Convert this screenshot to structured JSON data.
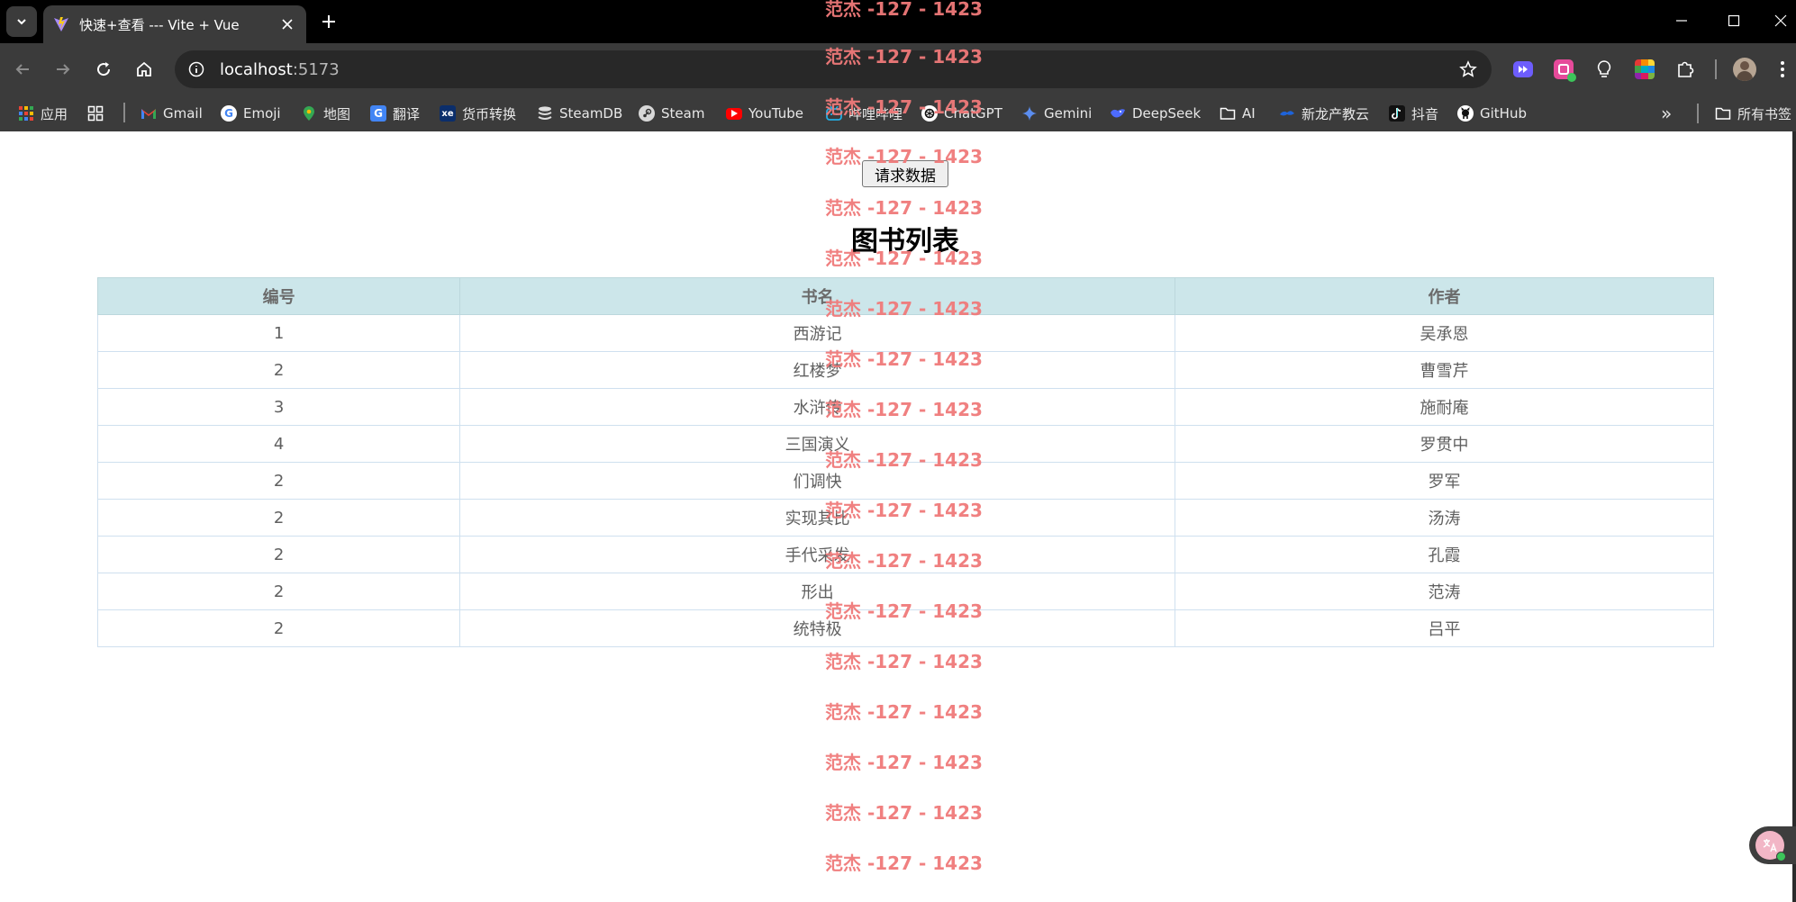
{
  "browser": {
    "tab": {
      "title": "快速+查看 --- Vite + Vue"
    },
    "address": {
      "host": "localhost",
      "port": ":5173"
    },
    "bookmarks": [
      {
        "label": "应用",
        "icon": "apps-grid-icon"
      },
      {
        "label": "",
        "icon": "tab-groups-icon"
      },
      {
        "label": "Gmail",
        "icon": "gmail-icon"
      },
      {
        "label": "Emoji",
        "icon": "google-icon"
      },
      {
        "label": "地图",
        "icon": "maps-icon"
      },
      {
        "label": "翻译",
        "icon": "translate-icon"
      },
      {
        "label": "货币转换",
        "icon": "xe-icon"
      },
      {
        "label": "SteamDB",
        "icon": "steamdb-icon"
      },
      {
        "label": "Steam",
        "icon": "steam-icon"
      },
      {
        "label": "YouTube",
        "icon": "youtube-icon"
      },
      {
        "label": "哔哩哔哩",
        "icon": "bilibili-icon"
      },
      {
        "label": "ChatGPT",
        "icon": "chatgpt-icon"
      },
      {
        "label": "Gemini",
        "icon": "gemini-icon"
      },
      {
        "label": "DeepSeek",
        "icon": "deepseek-icon"
      },
      {
        "label": "AI",
        "icon": "folder-icon"
      },
      {
        "label": "新龙产教云",
        "icon": "cloud-icon"
      },
      {
        "label": "抖音",
        "icon": "douyin-icon"
      },
      {
        "label": "GitHub",
        "icon": "github-icon"
      }
    ],
    "more_bookmarks": "»",
    "all_bookmarks": "所有书签"
  },
  "page": {
    "request_button": "请求数据",
    "heading": "图书列表",
    "table": {
      "headers": [
        "编号",
        "书名",
        "作者"
      ],
      "rows": [
        [
          "1",
          "西游记",
          "吴承恩"
        ],
        [
          "2",
          "红楼梦",
          "曹雪芹"
        ],
        [
          "3",
          "水浒传",
          "施耐庵"
        ],
        [
          "4",
          "三国演义",
          "罗贯中"
        ],
        [
          "2",
          "们调快",
          "罗军"
        ],
        [
          "2",
          "实现其比",
          "汤涛"
        ],
        [
          "2",
          "手代采发",
          "孔霞"
        ],
        [
          "2",
          "形出",
          "范涛"
        ],
        [
          "2",
          "统特极",
          "吕平"
        ]
      ]
    },
    "watermark": "范杰 -127 - 1423"
  },
  "colors": {
    "header_bg": "#cce6ea",
    "watermark": "#f07a7a",
    "chrome_dark": "#3b3b3b"
  }
}
